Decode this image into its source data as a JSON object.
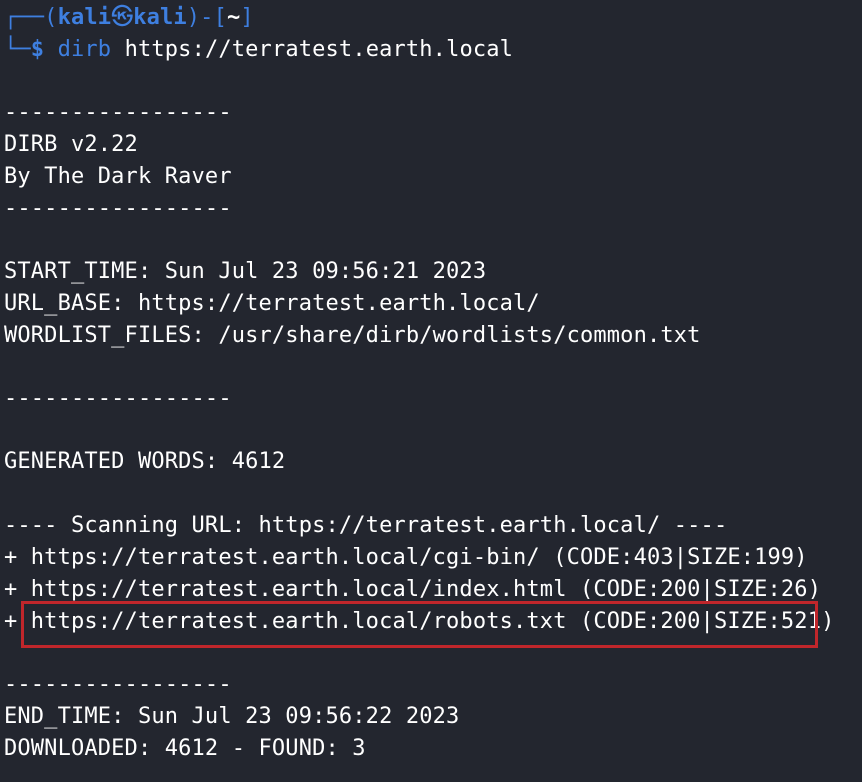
{
  "prompt": {
    "corner_top": "┌──(",
    "user": "kali",
    "skull": "㉿",
    "host": "kali",
    "close_paren": ")-[",
    "cwd": "~",
    "close_bracket": "]",
    "corner_bottom": "└─",
    "dollar": "$",
    "command": "dirb",
    "argument": " https://terratest.earth.local"
  },
  "output": {
    "sep1": "-----------------",
    "version": "DIRB v2.22",
    "author": "By The Dark Raver",
    "sep2": "-----------------",
    "start_time": "START_TIME: Sun Jul 23 09:56:21 2023",
    "url_base": "URL_BASE: https://terratest.earth.local/",
    "wordlist": "WORDLIST_FILES: /usr/share/dirb/wordlists/common.txt",
    "sep3": "-----------------",
    "generated": "GENERATED WORDS: 4612",
    "scanning": "---- Scanning URL: https://terratest.earth.local/ ----",
    "result1": "+ https://terratest.earth.local/cgi-bin/ (CODE:403|SIZE:199)",
    "result2": "+ https://terratest.earth.local/index.html (CODE:200|SIZE:26)",
    "result3": "+ https://terratest.earth.local/robots.txt (CODE:200|SIZE:521)",
    "sep4": "-----------------",
    "end_time": "END_TIME: Sun Jul 23 09:56:22 2023",
    "downloaded": "DOWNLOADED: 4612 - FOUND: 3"
  },
  "colors": {
    "background": "#23262f",
    "prompt_blue": "#3e7fe0",
    "text": "#ffffff",
    "highlight_border": "#c0262b"
  }
}
